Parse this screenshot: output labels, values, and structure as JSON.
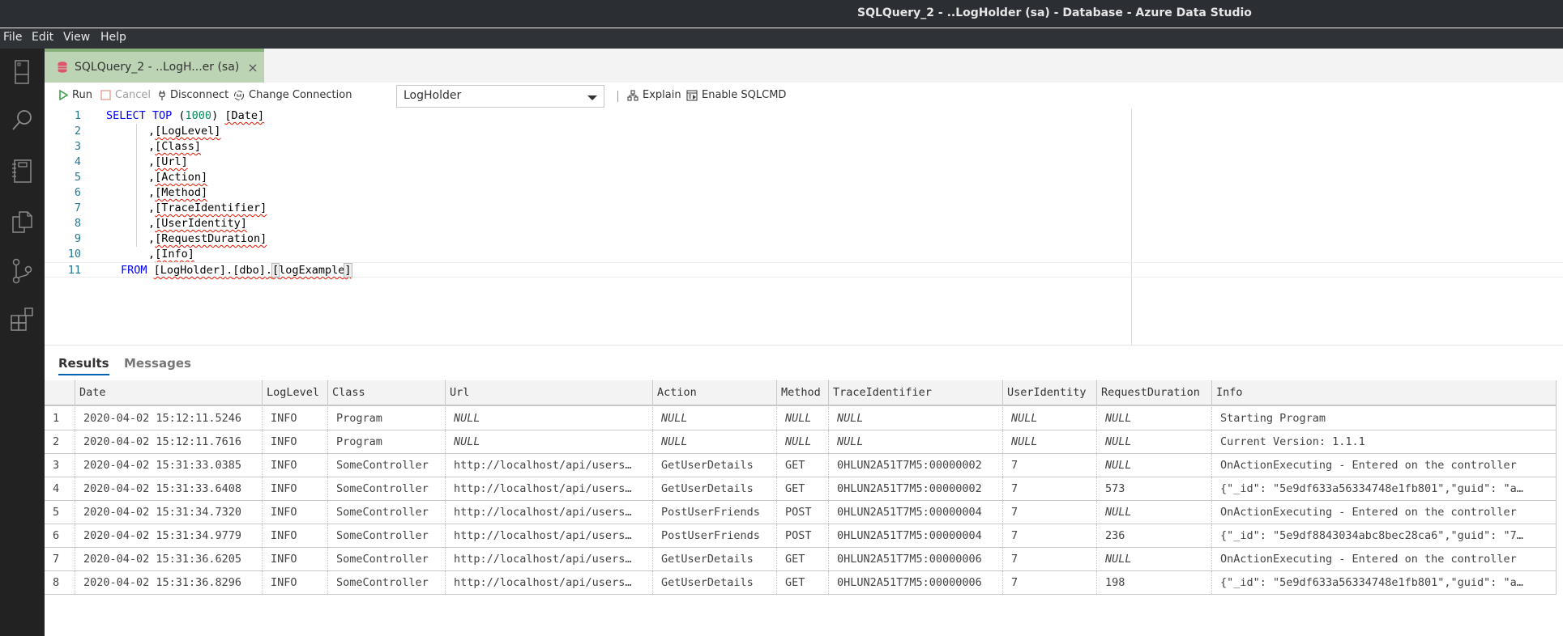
{
  "window": {
    "title": "SQLQuery_2 - ..LogHolder (sa) - Database - Azure Data Studio"
  },
  "menu": {
    "items": [
      "File",
      "Edit",
      "View",
      "Help"
    ]
  },
  "activity_bar": {
    "items": [
      {
        "name": "connections",
        "icon": "server-icon"
      },
      {
        "name": "search",
        "icon": "search-icon"
      },
      {
        "name": "notebooks",
        "icon": "notebook-icon"
      },
      {
        "name": "explorer",
        "icon": "files-icon"
      },
      {
        "name": "source-control",
        "icon": "source-control-icon"
      },
      {
        "name": "extensions",
        "icon": "extensions-icon"
      }
    ]
  },
  "tab": {
    "label": "SQLQuery_2 - ..LogH...er (sa)",
    "close": "×",
    "icon": "database-icon",
    "icon_color": "#e0536c"
  },
  "toolbar": {
    "run": "Run",
    "cancel": "Cancel",
    "disconnect": "Disconnect",
    "change_connection": "Change Connection",
    "database": "LogHolder",
    "explain": "Explain",
    "enable_sqlcmd": "Enable SQLCMD"
  },
  "editor": {
    "line_numbers": [
      "1",
      "2",
      "3",
      "4",
      "5",
      "6",
      "7",
      "8",
      "9",
      "10",
      "11"
    ],
    "lines": [
      {
        "kw": "SELECT TOP",
        "p1": " (",
        "num": "1000",
        "p2": ") ",
        "id": "[Date]"
      },
      {
        "prefix": ",",
        "id": "[LogLevel]"
      },
      {
        "prefix": ",",
        "id": "[Class]"
      },
      {
        "prefix": ",",
        "id": "[Url]"
      },
      {
        "prefix": ",",
        "id": "[Action]"
      },
      {
        "prefix": ",",
        "id": "[Method]"
      },
      {
        "prefix": ",",
        "id": "[TraceIdentifier]"
      },
      {
        "prefix": ",",
        "id": "[UserIdentity]"
      },
      {
        "prefix": ",",
        "id": "[RequestDuration]"
      },
      {
        "prefix": ",",
        "id": "[Info]"
      },
      {
        "kw": "FROM",
        "id1": "[LogHolder]",
        "dot1": ".",
        "id2": "[dbo]",
        "dot2": ".",
        "id3_open": "[",
        "id3": "logExample",
        "id3_close": "]"
      }
    ]
  },
  "results": {
    "tabs": [
      "Results",
      "Messages"
    ],
    "active_tab": "Results",
    "columns": [
      "",
      "Date",
      "LogLevel",
      "Class",
      "Url",
      "Action",
      "Method",
      "TraceIdentifier",
      "UserIdentity",
      "RequestDuration",
      "Info"
    ],
    "rows": [
      [
        "1",
        "2020-04-02 15:12:11.5246",
        "INFO",
        "Program",
        "NULL",
        "NULL",
        "NULL",
        "NULL",
        "NULL",
        "NULL",
        "Starting Program"
      ],
      [
        "2",
        "2020-04-02 15:12:11.7616",
        "INFO",
        "Program",
        "NULL",
        "NULL",
        "NULL",
        "NULL",
        "NULL",
        "NULL",
        "Current Version: 1.1.1"
      ],
      [
        "3",
        "2020-04-02 15:31:33.0385",
        "INFO",
        "SomeController",
        "http://localhost/api/users…",
        "GetUserDetails",
        "GET",
        "0HLUN2A51T7M5:00000002",
        "7",
        "NULL",
        "OnActionExecuting - Entered on the controller"
      ],
      [
        "4",
        "2020-04-02 15:31:33.6408",
        "INFO",
        "SomeController",
        "http://localhost/api/users…",
        "GetUserDetails",
        "GET",
        "0HLUN2A51T7M5:00000002",
        "7",
        "573",
        "{\"_id\": \"5e9df633a56334748e1fb801\",\"guid\": \"a…"
      ],
      [
        "5",
        "2020-04-02 15:31:34.7320",
        "INFO",
        "SomeController",
        "http://localhost/api/users…",
        "PostUserFriends",
        "POST",
        "0HLUN2A51T7M5:00000004",
        "7",
        "NULL",
        "OnActionExecuting - Entered on the controller"
      ],
      [
        "6",
        "2020-04-02 15:31:34.9779",
        "INFO",
        "SomeController",
        "http://localhost/api/users…",
        "PostUserFriends",
        "POST",
        "0HLUN2A51T7M5:00000004",
        "7",
        "236",
        "{\"_id\": \"5e9df8843034abc8bec28ca6\",\"guid\": \"7…"
      ],
      [
        "7",
        "2020-04-02 15:31:36.6205",
        "INFO",
        "SomeController",
        "http://localhost/api/users…",
        "GetUserDetails",
        "GET",
        "0HLUN2A51T7M5:00000006",
        "7",
        "NULL",
        "OnActionExecuting - Entered on the controller"
      ],
      [
        "8",
        "2020-04-02 15:31:36.8296",
        "INFO",
        "SomeController",
        "http://localhost/api/users…",
        "GetUserDetails",
        "GET",
        "0HLUN2A51T7M5:00000006",
        "7",
        "198",
        "{\"_id\": \"5e9df633a56334748e1fb801\",\"guid\": \"a…"
      ]
    ]
  },
  "colors": {
    "titlebar": "#2b2e33",
    "activitybar": "#222222",
    "tab_active": "#bcd4b4",
    "tab_accent": "#87b07a",
    "keyword": "#0000ff",
    "number": "#09885a",
    "line_number": "#237893",
    "run_icon": "#3fa14a",
    "results_tab_underline": "#0063b1"
  }
}
